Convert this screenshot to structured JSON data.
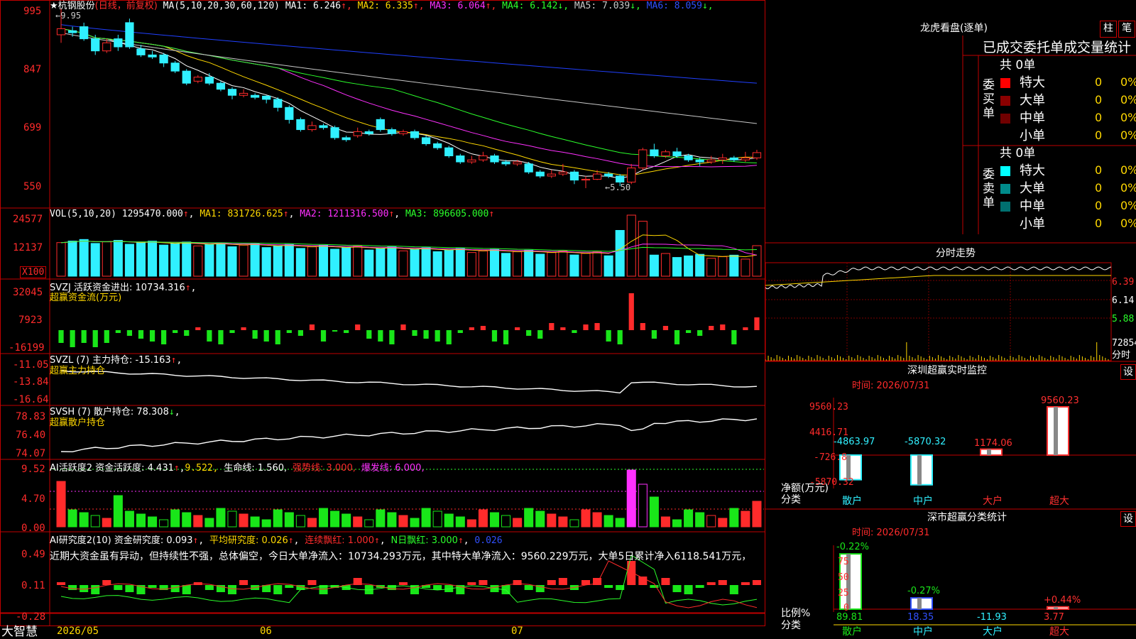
{
  "stock": {
    "name_star": "★杭钢股份",
    "mode": "(日线，前复权)",
    "ma_label": "MA(5,10,20,30,60,120)"
  },
  "ma_values": [
    {
      "k": "MA1:",
      "v": "6.246",
      "arrow": "↑",
      "color": "#ffffff"
    },
    {
      "k": "MA2:",
      "v": "6.335",
      "arrow": "↑",
      "color": "#ffd800"
    },
    {
      "k": "MA3:",
      "v": "6.064",
      "arrow": "↑",
      "color": "#ff30ff"
    },
    {
      "k": "MA4:",
      "v": "6.142",
      "arrow": "↓",
      "color": "#2bff2b"
    },
    {
      "k": "MA5:",
      "v": "7.039",
      "arrow": "↓",
      "color": "#c8c8c8"
    },
    {
      "k": "MA6:",
      "v": "8.059",
      "arrow": "↓",
      "color": "#3050ff"
    }
  ],
  "price_axis": [
    "995",
    "847",
    "699",
    "550"
  ],
  "price_marks": {
    "high": "←9.95",
    "low": "←5.50"
  },
  "vol": {
    "label": "VOL(5,10,20)",
    "v": "1295470.000",
    "ma1": "MA1: 831726.625",
    "ma2": "MA2: 1211316.500",
    "ma3": "MA3: 896605.000",
    "axis": [
      "24577",
      "12137",
      "X100"
    ]
  },
  "svzj": {
    "label": "SVZJ  活跃资金进出: 10734.316",
    "sub": "超赢资金流(万元)",
    "axis": [
      "32045",
      "7923",
      "-16199"
    ]
  },
  "svzl": {
    "label": "SVZL (7) 主力持仓: -15.163",
    "sub": "超赢主力持仓",
    "axis": [
      "-11.05",
      "-13.84",
      "-16.64"
    ]
  },
  "svsh": {
    "label": "SVSH (7) 散户持仓: 78.308",
    "sub": "超赢散户持仓",
    "axis": [
      "78.83",
      "76.40",
      "74.07"
    ]
  },
  "ai1": {
    "label": "AI活跃度2 资金活跃度: 4.431",
    "v2": "9.522,",
    "life": "生命线: 1.560,",
    "strong": "强势线: 3.000,",
    "burst": "爆发线: 6.000,",
    "axis": [
      "9.52",
      "4.70",
      "0.00"
    ]
  },
  "ai2": {
    "label": "AI研究度2(10) 资金研究度: 0.093",
    "avg": "平均研究度: 0.026",
    "red": "连续飘红: 1.000",
    "nred": "N日飘红: 3.000",
    "last": "0.026",
    "axis": [
      "0.49",
      "0.11",
      "-0.28"
    ],
    "note": "近期大资金虽有异动，但持续性不强，总体偏空，今日大单净流入：10734.293万元，其中特大单净流入：9560.229万元，大单5日累计净入6118.541万元，"
  },
  "xaxis": {
    "brand": "大智慧",
    "labels": [
      "2026/05",
      "06",
      "07"
    ]
  },
  "lhb": {
    "title": "龙虎看盘(逐单)",
    "btn1": "柱",
    "btn2": "笔",
    "header": "已成交委托单成交量统计",
    "buy": {
      "side": "委买单",
      "total": "共 0单",
      "rows": [
        {
          "name": "特大",
          "n": "0",
          "p": "0%",
          "color": "#ff0000"
        },
        {
          "name": "大单",
          "n": "0",
          "p": "0%",
          "color": "#8b0000"
        },
        {
          "name": "中单",
          "n": "0",
          "p": "0%",
          "color": "#700000"
        },
        {
          "name": "小单",
          "n": "0",
          "p": "0%",
          "color": "#000000"
        }
      ]
    },
    "sell": {
      "side": "委卖单",
      "total": "共 0单",
      "rows": [
        {
          "name": "特大",
          "n": "0",
          "p": "0%",
          "color": "#00ffff"
        },
        {
          "name": "大单",
          "n": "0",
          "p": "0%",
          "color": "#008b8b"
        },
        {
          "name": "中单",
          "n": "0",
          "p": "0%",
          "color": "#007070"
        },
        {
          "name": "小单",
          "n": "0",
          "p": "0%",
          "color": "#000000"
        }
      ]
    }
  },
  "fenshi": {
    "title": "分时走势",
    "axis": [
      "6.39",
      "6.14",
      "5.88",
      "72854"
    ],
    "unit": "分时"
  },
  "sz_monitor": {
    "title": "深圳超赢实时监控",
    "btn": "设",
    "time": "时间: 2026/07/31",
    "axis": [
      "9560.23",
      "4416.71",
      "-726.8",
      "-5870.32"
    ],
    "yname": "净额(万元)",
    "xname": "分类"
  },
  "sz_class": {
    "title": "深市超赢分类统计",
    "btn": "设",
    "time": "时间: 2026/07/31",
    "axis": [
      "75",
      "50",
      "25",
      "0"
    ],
    "yname": "比例%",
    "xname": "分类"
  },
  "chart_data": [
    {
      "type": "bar",
      "title": "深圳超赢实时监控",
      "categories": [
        "散户",
        "中户",
        "大户",
        "超大"
      ],
      "values": [
        -4863.97,
        -5870.32,
        1174.06,
        9560.23
      ],
      "ylabel": "净额(万元)",
      "xlabel": "分类",
      "ylim": [
        -5870.32,
        9560.23
      ]
    },
    {
      "type": "bar",
      "title": "深市超赢分类统计",
      "categories": [
        "散户",
        "中户",
        "大户",
        "超大"
      ],
      "values": [
        89.81,
        18.35,
        -11.93,
        3.77
      ],
      "ratios": [
        "-0.22%",
        "-0.27%",
        "",
        "+0.44%"
      ],
      "ylabel": "比例%",
      "xlabel": "分类",
      "ylim": [
        0,
        90
      ]
    },
    {
      "type": "candlestick",
      "title": "杭钢股份 日线",
      "ylim": [
        5.5,
        9.95
      ],
      "candles": [
        [
          9.3,
          9.45,
          9.95,
          9.1
        ],
        [
          9.4,
          9.35,
          9.5,
          9.25
        ],
        [
          9.5,
          9.2,
          9.6,
          9.15
        ],
        [
          9.2,
          8.9,
          9.3,
          8.8
        ],
        [
          8.9,
          9.1,
          9.2,
          8.85
        ],
        [
          9.2,
          9.0,
          9.3,
          8.9
        ],
        [
          9.6,
          9.0,
          9.7,
          8.95
        ],
        [
          8.95,
          8.8,
          9.05,
          8.75
        ],
        [
          8.8,
          8.75,
          8.9,
          8.7
        ],
        [
          8.8,
          8.6,
          8.85,
          8.5
        ],
        [
          8.6,
          8.4,
          8.65,
          8.35
        ],
        [
          8.4,
          8.1,
          8.45,
          8.05
        ],
        [
          8.15,
          8.25,
          8.3,
          8.1
        ],
        [
          8.25,
          8.1,
          8.35,
          8.05
        ],
        [
          8.1,
          7.95,
          8.15,
          7.9
        ],
        [
          7.95,
          7.8,
          8.0,
          7.7
        ],
        [
          7.8,
          7.85,
          7.95,
          7.75
        ],
        [
          7.8,
          7.75,
          7.85,
          7.7
        ],
        [
          7.78,
          7.7,
          7.8,
          7.6
        ],
        [
          7.7,
          7.5,
          7.75,
          7.4
        ],
        [
          7.5,
          7.2,
          7.55,
          7.1
        ],
        [
          7.2,
          6.95,
          7.25,
          6.9
        ],
        [
          6.95,
          7.05,
          7.15,
          6.9
        ],
        [
          7.05,
          7.0,
          7.1,
          6.95
        ],
        [
          7.0,
          6.75,
          7.05,
          6.7
        ],
        [
          6.75,
          6.7,
          6.8,
          6.65
        ],
        [
          6.8,
          6.9,
          7.0,
          6.75
        ],
        [
          6.9,
          6.85,
          6.95,
          6.8
        ],
        [
          7.2,
          6.95,
          7.25,
          6.9
        ],
        [
          6.95,
          6.85,
          7.0,
          6.8
        ],
        [
          6.85,
          6.9,
          6.95,
          6.8
        ],
        [
          6.9,
          6.75,
          6.95,
          6.7
        ],
        [
          6.75,
          6.6,
          6.8,
          6.55
        ],
        [
          6.6,
          6.5,
          6.65,
          6.45
        ],
        [
          6.5,
          6.3,
          6.55,
          6.25
        ],
        [
          6.3,
          6.15,
          6.35,
          6.1
        ],
        [
          6.15,
          6.2,
          6.3,
          6.1
        ],
        [
          6.2,
          6.3,
          6.4,
          6.15
        ],
        [
          6.3,
          6.15,
          6.35,
          6.1
        ],
        [
          6.15,
          6.1,
          6.2,
          6.05
        ],
        [
          6.1,
          6.15,
          6.2,
          6.05
        ],
        [
          6.1,
          5.9,
          6.15,
          5.85
        ],
        [
          5.9,
          5.8,
          5.95,
          5.75
        ],
        [
          5.8,
          5.85,
          5.95,
          5.75
        ],
        [
          5.85,
          5.9,
          6.1,
          5.8
        ],
        [
          5.9,
          5.7,
          5.95,
          5.6
        ],
        [
          5.7,
          5.72,
          5.8,
          5.5
        ],
        [
          5.72,
          5.85,
          5.95,
          5.7
        ],
        [
          5.85,
          5.8,
          5.9,
          5.75
        ],
        [
          5.8,
          5.65,
          5.85,
          5.55
        ],
        [
          5.65,
          6.0,
          6.1,
          5.6
        ],
        [
          6.0,
          6.45,
          6.5,
          5.95
        ],
        [
          6.45,
          6.3,
          6.6,
          6.25
        ],
        [
          6.3,
          6.4,
          6.45,
          6.25
        ],
        [
          6.4,
          6.3,
          6.5,
          6.25
        ],
        [
          6.3,
          6.2,
          6.35,
          6.15
        ],
        [
          6.2,
          6.15,
          6.25,
          6.05
        ],
        [
          6.15,
          6.2,
          6.3,
          6.1
        ],
        [
          6.2,
          6.25,
          6.35,
          6.1
        ],
        [
          6.25,
          6.2,
          6.3,
          6.15
        ],
        [
          6.2,
          6.25,
          6.4,
          6.15
        ],
        [
          6.25,
          6.38,
          6.45,
          6.2
        ]
      ]
    }
  ],
  "colors": {
    "up": "#ff2b2b",
    "down": "#30f0ff",
    "frame": "#c00000",
    "grid": "#7a0000"
  }
}
